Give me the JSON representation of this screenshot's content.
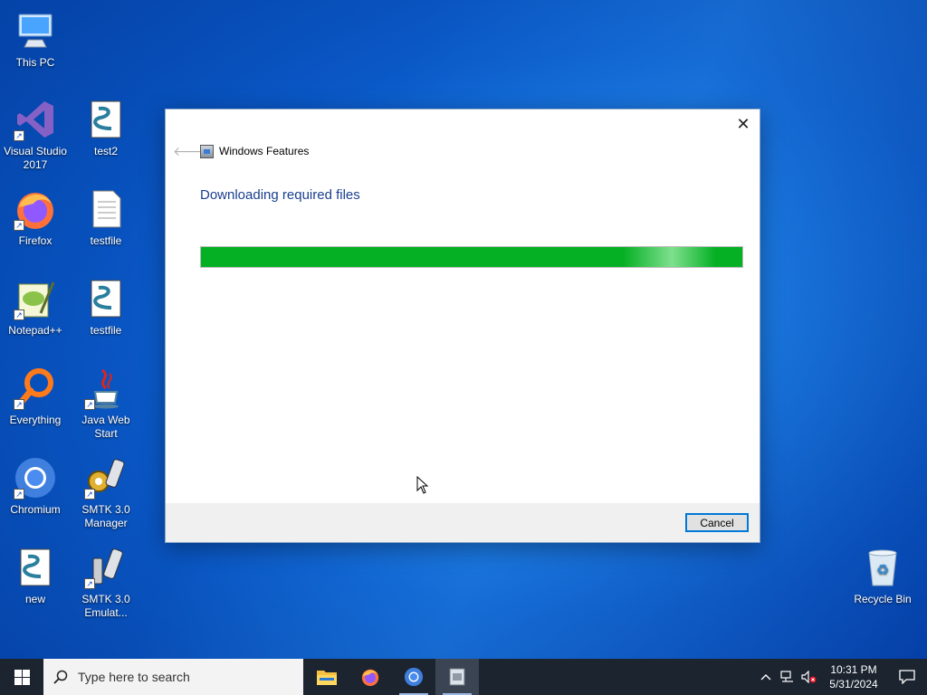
{
  "desktop": {
    "icons": [
      {
        "label": "This PC"
      },
      {
        "label": "Visual Studio 2017"
      },
      {
        "label": "test2"
      },
      {
        "label": "Firefox"
      },
      {
        "label": "testfile"
      },
      {
        "label": "Notepad++"
      },
      {
        "label": "testfile"
      },
      {
        "label": "Everything"
      },
      {
        "label": "Java Web Start"
      },
      {
        "label": "Chromium"
      },
      {
        "label": "SMTK 3.0 Manager"
      },
      {
        "label": "new"
      },
      {
        "label": "SMTK 3.0 Emulat..."
      },
      {
        "label": "Recycle Bin"
      }
    ]
  },
  "dialog": {
    "title": "Windows Features",
    "heading": "Downloading required files",
    "progress": 1.0,
    "cancel_label": "Cancel",
    "close_glyph": "✕",
    "back_glyph": "🡐"
  },
  "taskbar": {
    "search_placeholder": "Type here to search",
    "apps": [
      "file-explorer-icon",
      "firefox-icon",
      "chromium-icon",
      "windows-features-icon"
    ],
    "clock_time": "10:31 PM",
    "clock_date": "5/31/2024"
  },
  "colors": {
    "progress_green": "#06b025",
    "heading_blue": "#1a3f8f",
    "taskbar": "#1c2430",
    "accent": "#0078d7"
  }
}
